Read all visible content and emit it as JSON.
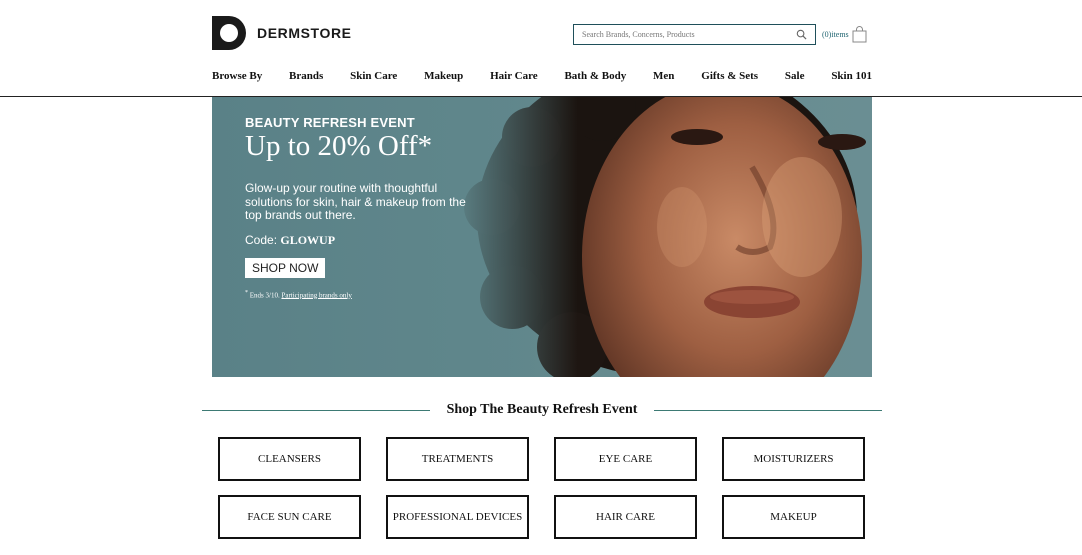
{
  "header": {
    "brand": "DERMSTORE",
    "search_placeholder": "Search Brands, Concerns, Products",
    "cart_label": "(0)items"
  },
  "nav": {
    "items": [
      "Browse By",
      "Brands",
      "Skin Care",
      "Makeup",
      "Hair Care",
      "Bath & Body",
      "Men",
      "Gifts & Sets",
      "Sale",
      "Skin 101"
    ]
  },
  "hero": {
    "eyebrow": "BEAUTY REFRESH EVENT",
    "headline": "Up to 20% Off*",
    "body": "Glow-up your routine with thoughtful solutions for skin, hair & makeup from the top brands out there.",
    "code_label": "Code:",
    "code": "GLOWUP",
    "cta": "SHOP NOW",
    "fine_print_mark": "*",
    "fine_print": "Ends 3/10.",
    "fine_print_link": "Participating brands only"
  },
  "section": {
    "title": "Shop The Beauty Refresh Event"
  },
  "categories": [
    "CLEANSERS",
    "TREATMENTS",
    "EYE CARE",
    "MOISTURIZERS",
    "FACE SUN CARE",
    "PROFESSIONAL DEVICES",
    "HAIR CARE",
    "MAKEUP"
  ],
  "colors": {
    "hero_bg": "#5f868b",
    "accent_teal": "#1f4f5a",
    "section_rule": "#3d7a74"
  },
  "icons": {
    "search": "search-icon",
    "bag": "shopping-bag-icon",
    "logo": "dermstore-logo-icon"
  }
}
